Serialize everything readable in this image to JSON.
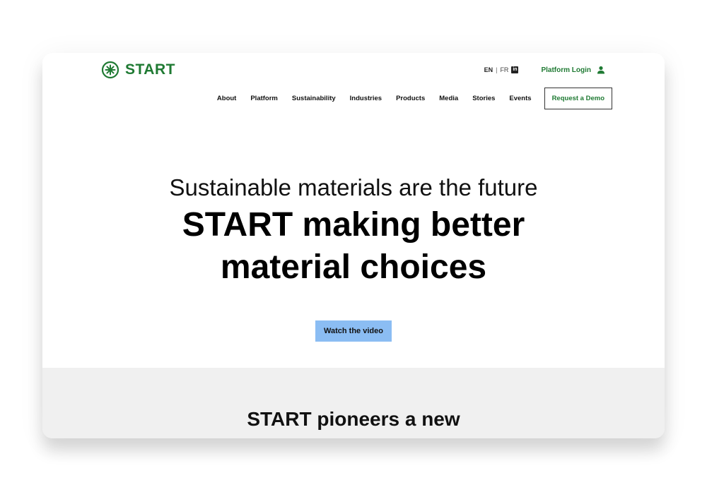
{
  "brand": {
    "name": "START",
    "color": "#1f7a33",
    "icon": "asterisk-circle-icon"
  },
  "topbar": {
    "lang_en": "EN",
    "lang_sep": "|",
    "lang_fr": "FR",
    "linkedin_icon": "in",
    "platform_login": "Platform Login",
    "user_icon": "user-icon"
  },
  "nav": {
    "items": [
      "About",
      "Platform",
      "Sustainability",
      "Industries",
      "Products",
      "Media",
      "Stories",
      "Events"
    ],
    "request_demo": "Request a Demo"
  },
  "hero": {
    "kicker": "Sustainable materials are the future",
    "headline_line1": "START making better",
    "headline_line2": "material choices",
    "cta": "Watch the video",
    "cta_color": "#8bbdf3"
  },
  "section2": {
    "title": "START pioneers a new"
  }
}
